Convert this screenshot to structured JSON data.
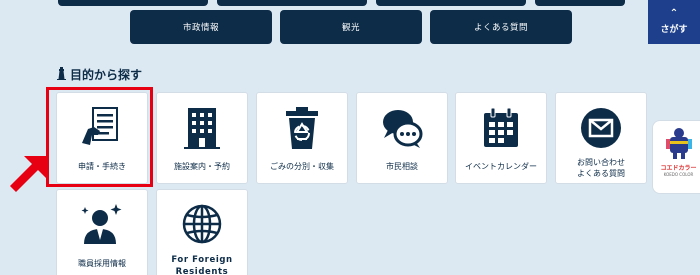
{
  "top_nav": {
    "items": [
      {
        "label": "市政情報"
      },
      {
        "label": "観光"
      },
      {
        "label": "よくある質問"
      }
    ],
    "search_label": "さがす"
  },
  "section": {
    "title": "目的から探す"
  },
  "tiles": [
    {
      "label": "申請・手続き",
      "icon": "application-form-icon"
    },
    {
      "label": "施設案内・予約",
      "icon": "building-icon"
    },
    {
      "label": "ごみの分別・収集",
      "icon": "recycle-bin-icon"
    },
    {
      "label": "市民相談",
      "icon": "speech-bubbles-icon"
    },
    {
      "label": "イベントカレンダー",
      "icon": "calendar-icon"
    },
    {
      "label": "お問い合わせ\nよくある質問",
      "icon": "mail-icon"
    },
    {
      "label": "職員採用情報",
      "icon": "staff-icon"
    },
    {
      "label": "For Foreign\nResidents",
      "icon": "globe-icon"
    }
  ],
  "mascot": {
    "text": "コエドカラー",
    "subtext": "KOEDO COLOR"
  },
  "colors": {
    "navy": "#0d2c48",
    "search_blue": "#1d3f8c",
    "background": "#dde9f2",
    "highlight_red": "#e60012"
  }
}
